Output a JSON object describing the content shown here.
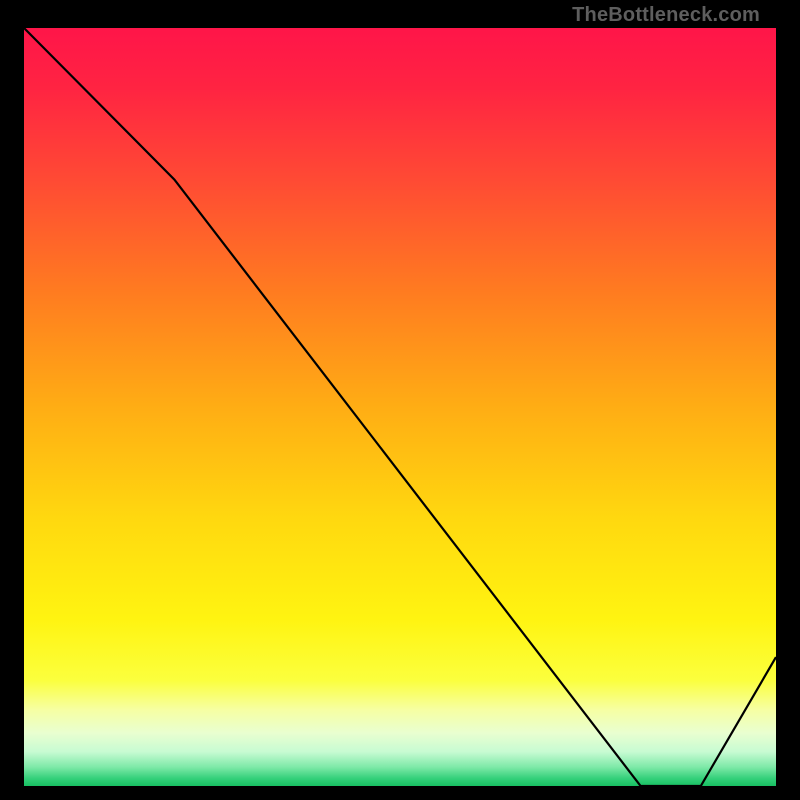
{
  "attribution": "TheBottleneck.com",
  "bottom_label": "",
  "chart_data": {
    "type": "line",
    "title": "",
    "xlabel": "",
    "ylabel": "",
    "xlim": [
      0,
      100
    ],
    "ylim": [
      0,
      100
    ],
    "x": [
      0,
      20,
      82,
      90,
      100
    ],
    "values": [
      100,
      80,
      0,
      0,
      17
    ],
    "fit_point": {
      "x": 86,
      "y": 0
    },
    "gradient_stops": [
      {
        "offset": 0.0,
        "color": "#ff1549"
      },
      {
        "offset": 0.08,
        "color": "#ff2442"
      },
      {
        "offset": 0.2,
        "color": "#ff4a34"
      },
      {
        "offset": 0.35,
        "color": "#ff7c20"
      },
      {
        "offset": 0.5,
        "color": "#ffad14"
      },
      {
        "offset": 0.65,
        "color": "#ffd90f"
      },
      {
        "offset": 0.78,
        "color": "#fff411"
      },
      {
        "offset": 0.86,
        "color": "#fbff3d"
      },
      {
        "offset": 0.9,
        "color": "#f6ffa4"
      },
      {
        "offset": 0.93,
        "color": "#e9ffd0"
      },
      {
        "offset": 0.955,
        "color": "#c7fbd2"
      },
      {
        "offset": 0.975,
        "color": "#7ee9a8"
      },
      {
        "offset": 0.99,
        "color": "#34d07a"
      },
      {
        "offset": 1.0,
        "color": "#18c062"
      }
    ]
  }
}
